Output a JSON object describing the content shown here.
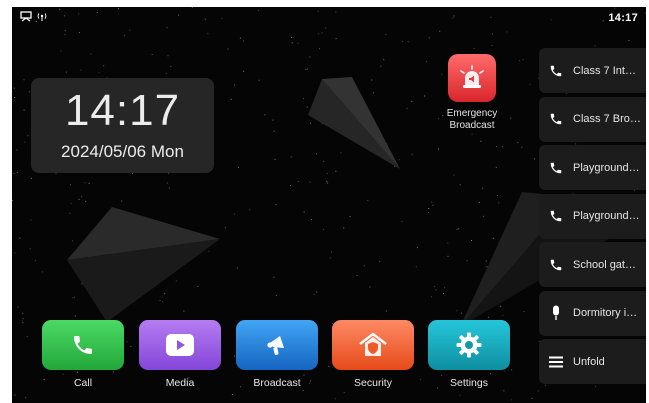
{
  "status_bar": {
    "time": "14:17",
    "icons": [
      "screen-cast-icon",
      "signal-icon"
    ]
  },
  "clock": {
    "time": "14:17",
    "date": "2024/05/06 Mon"
  },
  "emergency": {
    "label_line1": "Emergency",
    "label_line2": "Broadcast",
    "icon": "siren-icon",
    "color": "#e53935"
  },
  "sidebar": {
    "items": [
      {
        "label": "Class 7 Inte…",
        "icon": "phone-icon"
      },
      {
        "label": "Class 7 Bro…",
        "icon": "phone-icon"
      },
      {
        "label": "Playground…",
        "icon": "phone-icon"
      },
      {
        "label": "Playground…",
        "icon": "phone-icon"
      },
      {
        "label": "School gat…",
        "icon": "phone-icon"
      },
      {
        "label": "Dormitory i…",
        "icon": "microphone-icon"
      },
      {
        "label": "Unfold",
        "icon": "menu-icon"
      }
    ]
  },
  "dock": {
    "apps": [
      {
        "label": "Call",
        "icon": "phone-icon",
        "color": "#2fbf4a"
      },
      {
        "label": "Media",
        "icon": "play-icon",
        "color": "#9b5de5"
      },
      {
        "label": "Broadcast",
        "icon": "megaphone-icon",
        "color": "#1e88e5"
      },
      {
        "label": "Security",
        "icon": "shield-home-icon",
        "color": "#f4511e"
      },
      {
        "label": "Settings",
        "icon": "gear-icon",
        "color": "#17a7b8"
      }
    ]
  }
}
